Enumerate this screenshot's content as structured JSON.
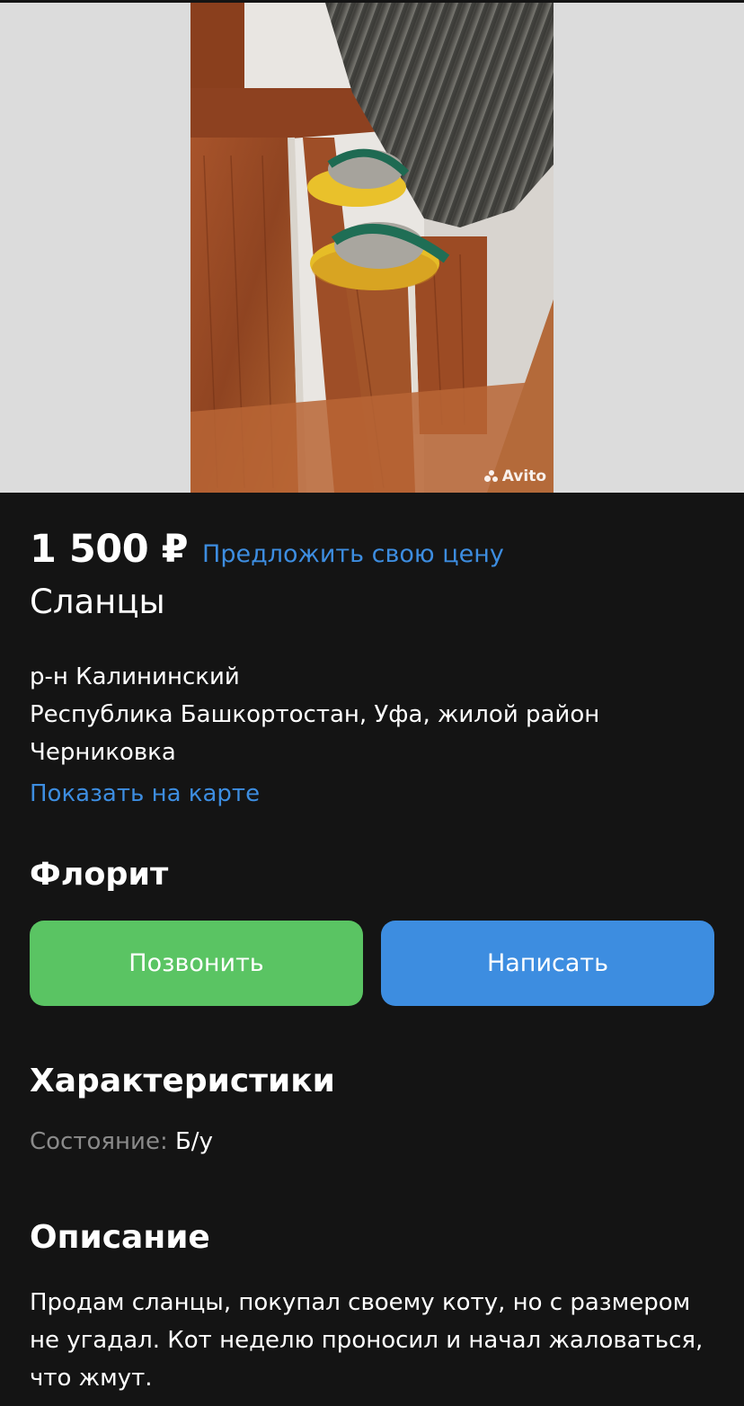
{
  "listing": {
    "watermark": "Avito",
    "price": "1 500 ₽",
    "offer_link": "Предложить свою цену",
    "title": "Сланцы",
    "address": {
      "district": "р-н Калининский",
      "line1": "Республика Башкортостан, Уфа, жилой район",
      "line2": "Черниковка",
      "map_link": "Показать на карте"
    },
    "seller_name": "Флорит",
    "call_button": "Позвонить",
    "write_button": "Написать",
    "characteristics": {
      "heading": "Характеристики",
      "condition_key": "Состояние:",
      "condition_value": "Б/у"
    },
    "description": {
      "heading": "Описание",
      "text": "Продам сланцы, покупал своему коту, но с размером не угадал. Кот неделю проносил и начал жаловаться, что жмут."
    }
  },
  "colors": {
    "background": "#141414",
    "link": "#3d8de0",
    "call_green": "#5ac463",
    "write_blue": "#3d8de0",
    "muted_text": "#8a8a8a"
  }
}
